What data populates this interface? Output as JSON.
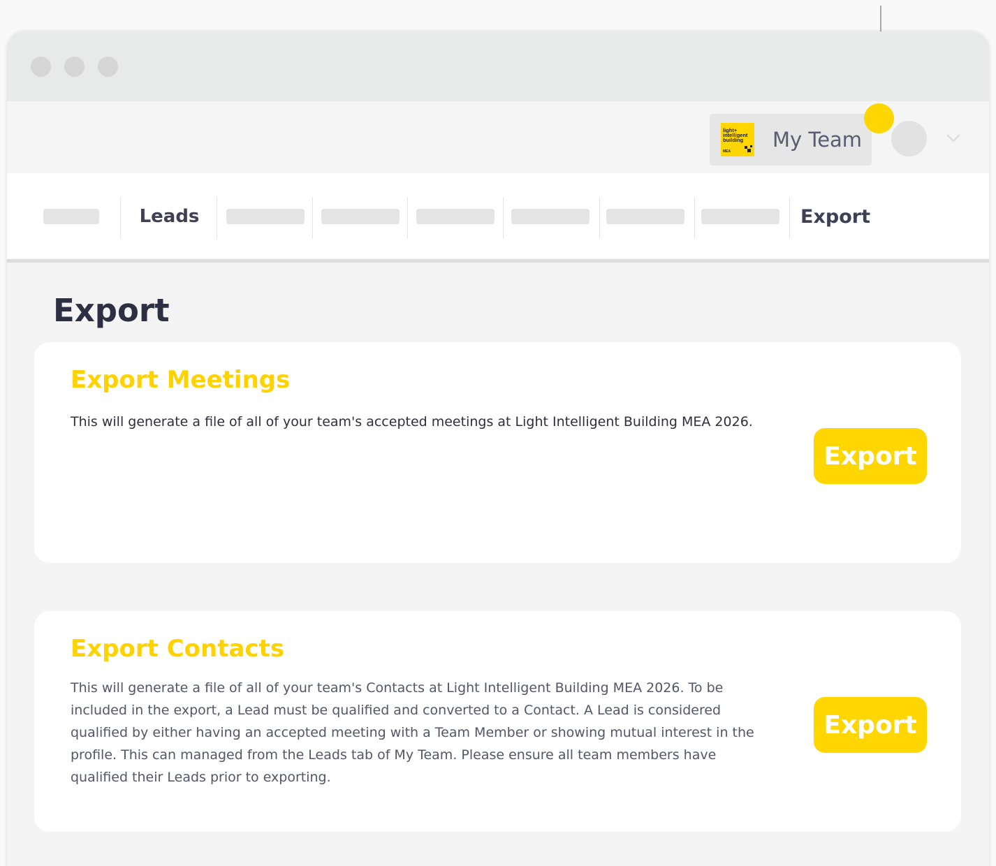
{
  "header": {
    "team_name": "My Team",
    "team_logo": {
      "line1": "light+",
      "line2": "intelligent",
      "line3": "building",
      "sub": "MEA"
    }
  },
  "nav": {
    "items": [
      {
        "label": "",
        "placeholder": true
      },
      {
        "label": "Leads",
        "placeholder": false
      },
      {
        "label": "",
        "placeholder": true
      },
      {
        "label": "",
        "placeholder": true
      },
      {
        "label": "",
        "placeholder": true
      },
      {
        "label": "",
        "placeholder": true
      },
      {
        "label": "",
        "placeholder": true
      },
      {
        "label": "",
        "placeholder": true
      },
      {
        "label": "Export",
        "placeholder": false
      }
    ]
  },
  "page": {
    "title": "Export"
  },
  "cards": {
    "meetings": {
      "title": "Export Meetings",
      "description": "This will generate a file of all of your team's accepted meetings at Light Intelligent Building MEA 2026.",
      "button_label": "Export"
    },
    "contacts": {
      "title": "Export Contacts",
      "description": "This will generate a file of all of your team's Contacts at Light Intelligent Building MEA 2026. To be included in the export, a Lead must be qualified and converted to a Contact. A Lead is considered qualified by either having an accepted meeting with a Team Member or showing mutual interest in the profile. This can managed from the Leads tab of My Team. Please ensure all team members have qualified their Leads prior to exporting.",
      "button_label": "Export"
    }
  },
  "colors": {
    "accent": "#ffd600",
    "title_text": "#2f2f44",
    "page_bg": "#f4f4f4"
  },
  "icons": [
    "chevron-down-icon",
    "avatar",
    "traffic-light-dot",
    "pointer-dot"
  ]
}
